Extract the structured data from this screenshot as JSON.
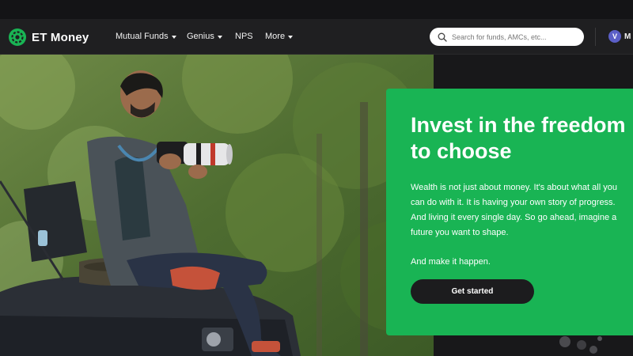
{
  "brand": {
    "name": "ET Money"
  },
  "nav": {
    "items": [
      {
        "label": "Mutual Funds",
        "dropdown": true
      },
      {
        "label": "Genius",
        "dropdown": true
      },
      {
        "label": "NPS",
        "dropdown": false
      },
      {
        "label": "More",
        "dropdown": true
      }
    ]
  },
  "search": {
    "placeholder": "Search for funds, AMCs, etc..."
  },
  "user": {
    "initial": "V",
    "label_truncated": "M"
  },
  "hero": {
    "title": "Invest in the freedom to choose",
    "body": "Wealth is not just about money. It's about what all you can do with it. It is having your own story of progress. And living it every single day. So go ahead, imagine a future you want to shape.",
    "tagline": "And make it happen.",
    "cta_label": "Get started"
  },
  "colors": {
    "accent": "#19b454",
    "navbar": "#1f1f21",
    "cta": "#1c1c1e"
  }
}
